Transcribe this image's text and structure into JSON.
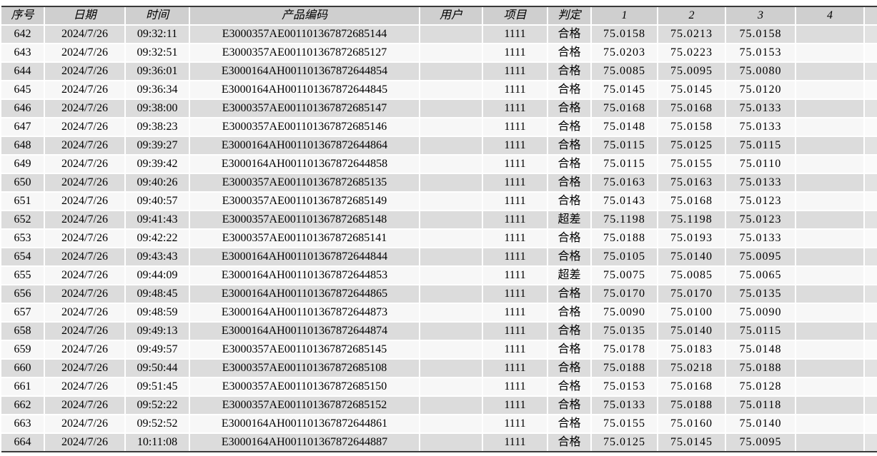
{
  "table": {
    "columns": [
      {
        "key": "seq",
        "label": "序号"
      },
      {
        "key": "date",
        "label": "日期"
      },
      {
        "key": "time",
        "label": "时间"
      },
      {
        "key": "code",
        "label": "产品编码"
      },
      {
        "key": "user",
        "label": "用户"
      },
      {
        "key": "project",
        "label": "项目"
      },
      {
        "key": "judge",
        "label": "判定"
      },
      {
        "key": "m1",
        "label": "1"
      },
      {
        "key": "m2",
        "label": "2"
      },
      {
        "key": "m3",
        "label": "3"
      },
      {
        "key": "m4",
        "label": "4"
      }
    ],
    "judge_labels": {
      "pass": "合格",
      "fail": "超差"
    },
    "colors": {
      "pass_bg": "#00ee00",
      "fail_bg": "#ff0000",
      "measure_bg": "#ff0000",
      "m4_bg": "#fc8000",
      "header_bg": "#cfcfcf",
      "row_shade_bg": "#dcdcdc",
      "row_light_bg": "#f7f7f7"
    },
    "rows": [
      {
        "seq": "642",
        "date": "2024/7/26",
        "time": "09:32:11",
        "code": "E3000357AE001101367872685144",
        "user": "",
        "project": "1111",
        "judge": "合格",
        "judge_status": "pass",
        "m1": "75.0158",
        "m2": "75.0213",
        "m3": "75.0158",
        "m4": ""
      },
      {
        "seq": "643",
        "date": "2024/7/26",
        "time": "09:32:51",
        "code": "E3000357AE001101367872685127",
        "user": "",
        "project": "1111",
        "judge": "合格",
        "judge_status": "pass",
        "m1": "75.0203",
        "m2": "75.0223",
        "m3": "75.0153",
        "m4": ""
      },
      {
        "seq": "644",
        "date": "2024/7/26",
        "time": "09:36:01",
        "code": "E3000164AH001101367872644854",
        "user": "",
        "project": "1111",
        "judge": "合格",
        "judge_status": "pass",
        "m1": "75.0085",
        "m2": "75.0095",
        "m3": "75.0080",
        "m4": ""
      },
      {
        "seq": "645",
        "date": "2024/7/26",
        "time": "09:36:34",
        "code": "E3000164AH001101367872644845",
        "user": "",
        "project": "1111",
        "judge": "合格",
        "judge_status": "pass",
        "m1": "75.0145",
        "m2": "75.0145",
        "m3": "75.0120",
        "m4": ""
      },
      {
        "seq": "646",
        "date": "2024/7/26",
        "time": "09:38:00",
        "code": "E3000357AE001101367872685147",
        "user": "",
        "project": "1111",
        "judge": "合格",
        "judge_status": "pass",
        "m1": "75.0168",
        "m2": "75.0168",
        "m3": "75.0133",
        "m4": ""
      },
      {
        "seq": "647",
        "date": "2024/7/26",
        "time": "09:38:23",
        "code": "E3000357AE001101367872685146",
        "user": "",
        "project": "1111",
        "judge": "合格",
        "judge_status": "pass",
        "m1": "75.0148",
        "m2": "75.0158",
        "m3": "75.0133",
        "m4": ""
      },
      {
        "seq": "648",
        "date": "2024/7/26",
        "time": "09:39:27",
        "code": "E3000164AH001101367872644864",
        "user": "",
        "project": "1111",
        "judge": "合格",
        "judge_status": "pass",
        "m1": "75.0115",
        "m2": "75.0125",
        "m3": "75.0115",
        "m4": ""
      },
      {
        "seq": "649",
        "date": "2024/7/26",
        "time": "09:39:42",
        "code": "E3000164AH001101367872644858",
        "user": "",
        "project": "1111",
        "judge": "合格",
        "judge_status": "pass",
        "m1": "75.0115",
        "m2": "75.0155",
        "m3": "75.0110",
        "m4": ""
      },
      {
        "seq": "650",
        "date": "2024/7/26",
        "time": "09:40:26",
        "code": "E3000357AE001101367872685135",
        "user": "",
        "project": "1111",
        "judge": "合格",
        "judge_status": "pass",
        "m1": "75.0163",
        "m2": "75.0163",
        "m3": "75.0133",
        "m4": ""
      },
      {
        "seq": "651",
        "date": "2024/7/26",
        "time": "09:40:57",
        "code": "E3000357AE001101367872685149",
        "user": "",
        "project": "1111",
        "judge": "合格",
        "judge_status": "pass",
        "m1": "75.0143",
        "m2": "75.0168",
        "m3": "75.0123",
        "m4": ""
      },
      {
        "seq": "652",
        "date": "2024/7/26",
        "time": "09:41:43",
        "code": "E3000357AE001101367872685148",
        "user": "",
        "project": "1111",
        "judge": "超差",
        "judge_status": "fail",
        "m1": "75.1198",
        "m2": "75.1198",
        "m3": "75.0123",
        "m4": ""
      },
      {
        "seq": "653",
        "date": "2024/7/26",
        "time": "09:42:22",
        "code": "E3000357AE001101367872685141",
        "user": "",
        "project": "1111",
        "judge": "合格",
        "judge_status": "pass",
        "m1": "75.0188",
        "m2": "75.0193",
        "m3": "75.0133",
        "m4": ""
      },
      {
        "seq": "654",
        "date": "2024/7/26",
        "time": "09:43:43",
        "code": "E3000164AH001101367872644844",
        "user": "",
        "project": "1111",
        "judge": "合格",
        "judge_status": "pass",
        "m1": "75.0105",
        "m2": "75.0140",
        "m3": "75.0095",
        "m4": ""
      },
      {
        "seq": "655",
        "date": "2024/7/26",
        "time": "09:44:09",
        "code": "E3000164AH001101367872644853",
        "user": "",
        "project": "1111",
        "judge": "超差",
        "judge_status": "fail",
        "m1": "75.0075",
        "m2": "75.0085",
        "m3": "75.0065",
        "m4": ""
      },
      {
        "seq": "656",
        "date": "2024/7/26",
        "time": "09:48:45",
        "code": "E3000164AH001101367872644865",
        "user": "",
        "project": "1111",
        "judge": "合格",
        "judge_status": "pass",
        "m1": "75.0170",
        "m2": "75.0170",
        "m3": "75.0135",
        "m4": ""
      },
      {
        "seq": "657",
        "date": "2024/7/26",
        "time": "09:48:59",
        "code": "E3000164AH001101367872644873",
        "user": "",
        "project": "1111",
        "judge": "合格",
        "judge_status": "pass",
        "m1": "75.0090",
        "m2": "75.0100",
        "m3": "75.0090",
        "m4": ""
      },
      {
        "seq": "658",
        "date": "2024/7/26",
        "time": "09:49:13",
        "code": "E3000164AH001101367872644874",
        "user": "",
        "project": "1111",
        "judge": "合格",
        "judge_status": "pass",
        "m1": "75.0135",
        "m2": "75.0140",
        "m3": "75.0115",
        "m4": ""
      },
      {
        "seq": "659",
        "date": "2024/7/26",
        "time": "09:49:57",
        "code": "E3000357AE001101367872685145",
        "user": "",
        "project": "1111",
        "judge": "合格",
        "judge_status": "pass",
        "m1": "75.0178",
        "m2": "75.0183",
        "m3": "75.0148",
        "m4": ""
      },
      {
        "seq": "660",
        "date": "2024/7/26",
        "time": "09:50:44",
        "code": "E3000357AE001101367872685108",
        "user": "",
        "project": "1111",
        "judge": "合格",
        "judge_status": "pass",
        "m1": "75.0188",
        "m2": "75.0218",
        "m3": "75.0188",
        "m4": ""
      },
      {
        "seq": "661",
        "date": "2024/7/26",
        "time": "09:51:45",
        "code": "E3000357AE001101367872685150",
        "user": "",
        "project": "1111",
        "judge": "合格",
        "judge_status": "pass",
        "m1": "75.0153",
        "m2": "75.0168",
        "m3": "75.0128",
        "m4": ""
      },
      {
        "seq": "662",
        "date": "2024/7/26",
        "time": "09:52:22",
        "code": "E3000357AE001101367872685152",
        "user": "",
        "project": "1111",
        "judge": "合格",
        "judge_status": "pass",
        "m1": "75.0133",
        "m2": "75.0188",
        "m3": "75.0118",
        "m4": ""
      },
      {
        "seq": "663",
        "date": "2024/7/26",
        "time": "09:52:52",
        "code": "E3000164AH001101367872644861",
        "user": "",
        "project": "1111",
        "judge": "合格",
        "judge_status": "pass",
        "m1": "75.0155",
        "m2": "75.0160",
        "m3": "75.0140",
        "m4": ""
      },
      {
        "seq": "664",
        "date": "2024/7/26",
        "time": "10:11:08",
        "code": "E3000164AH001101367872644887",
        "user": "",
        "project": "1111",
        "judge": "合格",
        "judge_status": "pass",
        "m1": "75.0125",
        "m2": "75.0145",
        "m3": "75.0095",
        "m4": ""
      }
    ]
  }
}
